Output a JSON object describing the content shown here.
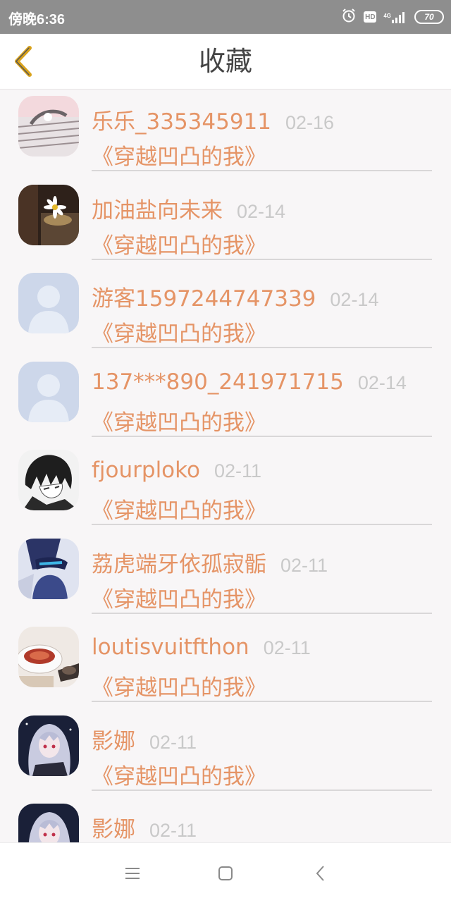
{
  "status_bar": {
    "time": "傍晚6:36",
    "network": "4G",
    "hd": "HD",
    "battery": "70"
  },
  "header": {
    "title": "收藏"
  },
  "favorites": [
    {
      "user": "乐乐_335345911",
      "date": "02-16",
      "title": "《穿越凹凸的我》"
    },
    {
      "user": "加油盐向未来",
      "date": "02-14",
      "title": "《穿越凹凸的我》"
    },
    {
      "user": "游客1597244747339",
      "date": "02-14",
      "title": "《穿越凹凸的我》"
    },
    {
      "user": "137***890_241971715",
      "date": "02-14",
      "title": "《穿越凹凸的我》"
    },
    {
      "user": "fjourploko",
      "date": "02-11",
      "title": "《穿越凹凸的我》"
    },
    {
      "user": "荔虎端牙依孤寂骺",
      "date": "02-11",
      "title": "《穿越凹凸的我》"
    },
    {
      "user": "loutisvuitfthon",
      "date": "02-11",
      "title": "《穿越凹凸的我》"
    },
    {
      "user": "影娜",
      "date": "02-11",
      "title": "《穿越凹凸的我》"
    },
    {
      "user": "影娜",
      "date": "02-11",
      "title": ""
    }
  ],
  "colors": {
    "accent": "#e59466",
    "date": "#c9c9c9",
    "back_icon": "#d9a21b"
  }
}
